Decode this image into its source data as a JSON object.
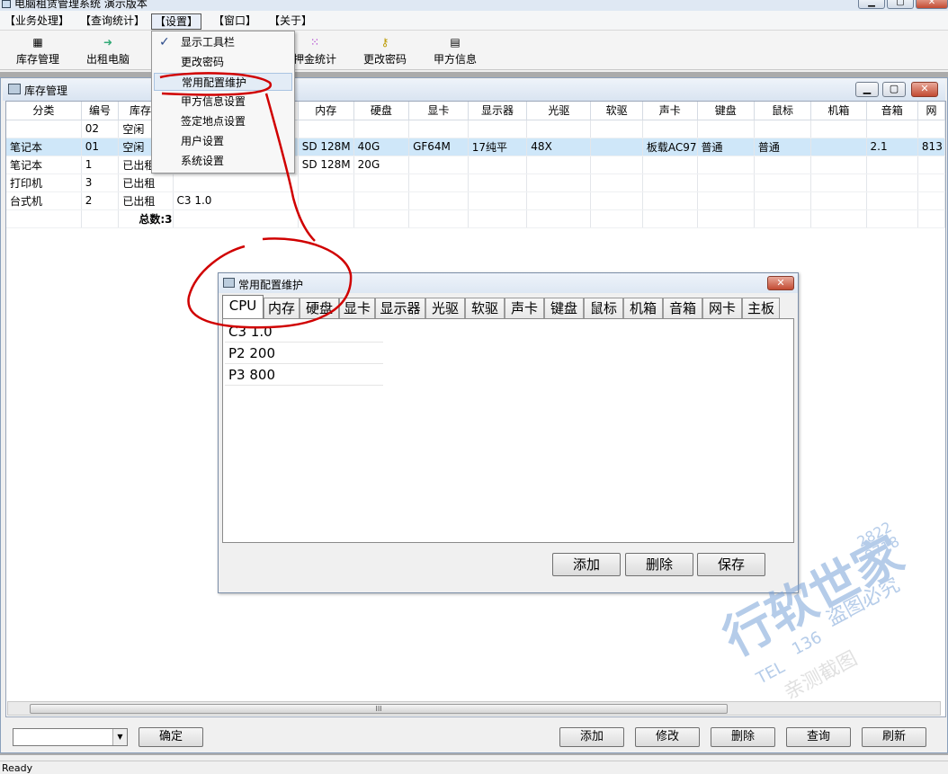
{
  "window": {
    "title": "电脑租赁管理系统    演示版本",
    "min_icon": "minimize-icon",
    "max_icon": "maximize-icon",
    "close_icon": "close-icon"
  },
  "menubar": {
    "items": [
      "【业务处理】",
      "【查询统计】",
      "【设置】",
      "【窗口】",
      "【关于】"
    ]
  },
  "toolbar": {
    "items": [
      {
        "label": "库存管理",
        "icon": "grid-icon"
      },
      {
        "label": "出租电脑",
        "icon": "rent-icon"
      },
      {
        "label": "押金统计",
        "icon": "dots-grid-icon"
      },
      {
        "label": "更改密码",
        "icon": "key-icon"
      },
      {
        "label": "甲方信息",
        "icon": "form-icon"
      }
    ]
  },
  "settings_menu": {
    "items": [
      {
        "label": "显示工具栏",
        "checked": true
      },
      {
        "label": "更改密码"
      },
      {
        "label": "常用配置维护",
        "hover": true
      },
      {
        "label": "甲方信息设置"
      },
      {
        "label": "签定地点设置"
      },
      {
        "label": "用户设置"
      },
      {
        "label": "系统设置"
      }
    ]
  },
  "inventory": {
    "title": "库存管理",
    "columns": [
      "分类",
      "编号",
      "库存状",
      "",
      "内存",
      "硬盘",
      "显卡",
      "显示器",
      "光驱",
      "软驱",
      "声卡",
      "键盘",
      "鼠标",
      "机箱",
      "音箱",
      "网"
    ],
    "rows": [
      [
        "",
        "02",
        "空闲",
        "",
        "",
        "",
        "",
        "",
        "",
        "",
        "",
        "",
        "",
        "",
        "",
        ""
      ],
      [
        "笔记本",
        "01",
        "空闲",
        "",
        "SD 128M",
        "40G",
        "GF64M",
        "17纯平",
        "48X",
        "",
        "板载AC97",
        "普通",
        "普通",
        "",
        "2.1",
        "813"
      ],
      [
        "笔记本",
        "1",
        "已出租",
        "",
        "SD 128M",
        "20G",
        "",
        "",
        "",
        "",
        "",
        "",
        "",
        "",
        "",
        ""
      ],
      [
        "打印机",
        "3",
        "已出租",
        "",
        "",
        "",
        "",
        "",
        "",
        "",
        "",
        "",
        "",
        "",
        "",
        ""
      ],
      [
        "台式机",
        "2",
        "已出租",
        "C3 1.0",
        "",
        "",
        "",
        "",
        "",
        "",
        "",
        "",
        "",
        "",
        "",
        ""
      ]
    ],
    "total_label": "总数:3",
    "scroll_grip": "III"
  },
  "bottom": {
    "confirm": "确定",
    "add": "添加",
    "modify": "修改",
    "delete": "删除",
    "query": "查询",
    "refresh": "刷新"
  },
  "status": "Ready",
  "dialog": {
    "title": "常用配置维护",
    "tabs": [
      "CPU",
      "内存",
      "硬盘",
      "显卡",
      "显示器",
      "光驱",
      "软驱",
      "声卡",
      "键盘",
      "鼠标",
      "机箱",
      "音箱",
      "网卡",
      "主板"
    ],
    "active_tab": "CPU",
    "items": [
      "C3 1.0",
      "P2 200",
      "P3 800"
    ],
    "buttons": {
      "add": "添加",
      "delete": "删除",
      "save": "保存"
    }
  },
  "watermark": {
    "main": "行软世家",
    "tel": "TEL",
    "num1": "136",
    "num2": "2822",
    "num3": "8718",
    "slogan": "盗图必究",
    "slogan2": "亲测截图"
  },
  "colors": {
    "accent": "#cfe7f9",
    "annotation": "#d00000"
  }
}
